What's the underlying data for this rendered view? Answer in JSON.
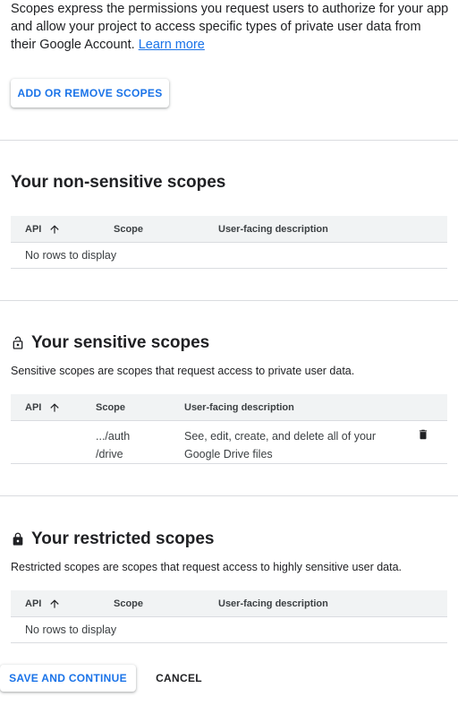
{
  "intro": {
    "text": "Scopes express the permissions you request users to authorize for your app and allow your project to access specific types of private user data from their Google Account.",
    "learn_more": "Learn more"
  },
  "add_remove_button": "ADD OR REMOVE SCOPES",
  "non_sensitive": {
    "title": "Your non-sensitive scopes",
    "columns": [
      "API",
      "Scope",
      "User-facing description"
    ],
    "empty_text": "No rows to display"
  },
  "sensitive": {
    "title": "Your sensitive scopes",
    "description": "Sensitive scopes are scopes that request access to private user data.",
    "columns": [
      "API",
      "Scope",
      "User-facing description"
    ],
    "rows": [
      {
        "api": "",
        "scope_line1": ".../auth",
        "scope_line2": "/drive",
        "desc_line1": "See, edit, create, and delete all of your",
        "desc_line2": "Google Drive files"
      }
    ]
  },
  "restricted": {
    "title": "Your restricted scopes",
    "description": "Restricted scopes are scopes that request access to highly sensitive user data.",
    "columns": [
      "API",
      "Scope",
      "User-facing description"
    ],
    "empty_text": "No rows to display"
  },
  "footer": {
    "save_label": "SAVE AND CONTINUE",
    "cancel_label": "CANCEL"
  },
  "icons": {
    "sort": "arrow-upward-icon",
    "lock_open": "lock-open-icon",
    "lock": "lock-icon",
    "delete": "trash-icon"
  },
  "colors": {
    "accent": "#1a73e8",
    "header_bg": "#f1f3f4",
    "divider": "#dadce0"
  }
}
